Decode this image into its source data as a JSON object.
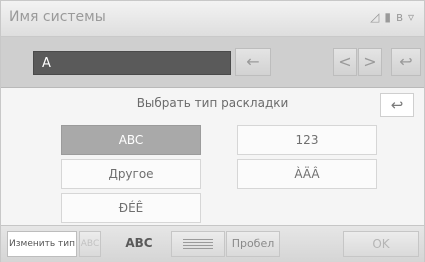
{
  "header": {
    "title": "Имя системы",
    "status_icons": [
      "signal-icon",
      "battery-icon",
      "bluetooth-icon",
      "wifi-icon"
    ]
  },
  "input": {
    "value": "A",
    "buttons": {
      "backspace": "←",
      "cursor_left": "<",
      "cursor_right": ">",
      "undo": "↩"
    }
  },
  "panel": {
    "heading": "Выбрать тип раскладки",
    "back": "↩",
    "options": [
      {
        "label": "ABC",
        "selected": true
      },
      {
        "label": "123",
        "selected": false
      },
      {
        "label": "Другое",
        "selected": false
      },
      {
        "label": "ÀÄÂ",
        "selected": false
      },
      {
        "label": "ĐÉÊ",
        "selected": false
      }
    ]
  },
  "bottom": {
    "change_type": "Изменить тип",
    "abc_faded": "ABC",
    "abc": "ABC",
    "space": "Пробел",
    "ok": "OK"
  },
  "colors": {
    "selected_option": "#a9a9a9",
    "input_field": "#5a5a5a"
  }
}
